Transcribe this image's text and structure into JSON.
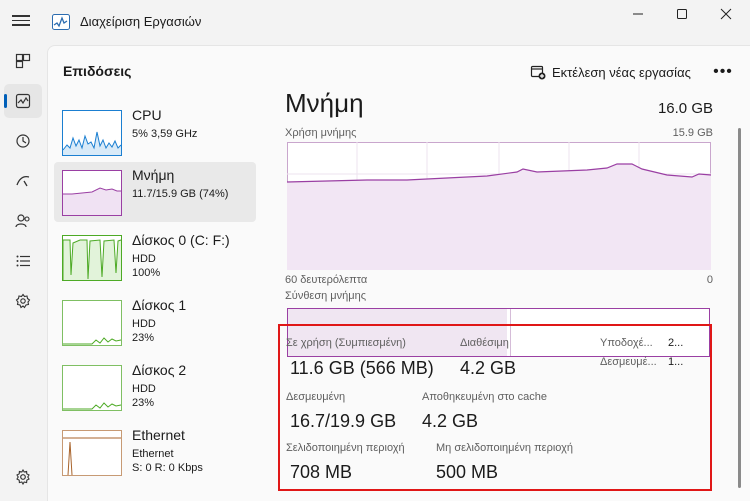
{
  "window": {
    "title": "Διαχείριση Εργασιών"
  },
  "header": {
    "title": "Επιδόσεις",
    "run_task_label": "Εκτέλεση νέας εργασίας",
    "more_label": "•••"
  },
  "rail": {
    "items": [
      {
        "icon": "processes-icon"
      },
      {
        "icon": "performance-icon",
        "active": true
      },
      {
        "icon": "app-history-icon"
      },
      {
        "icon": "startup-apps-icon"
      },
      {
        "icon": "users-icon"
      },
      {
        "icon": "details-icon"
      },
      {
        "icon": "services-icon"
      }
    ],
    "settings_icon": "gear-icon"
  },
  "devices": [
    {
      "name": "CPU",
      "line1": "5%  3,59 GHz",
      "line2": "",
      "color": "#1b7fd1"
    },
    {
      "name": "Μνήμη",
      "line1": "11.7/15.9 GB (74%)",
      "line2": "",
      "color": "#9a3fa3",
      "active": true
    },
    {
      "name": "Δίσκος 0 (C: F:)",
      "line1": "HDD",
      "line2": "100%",
      "color": "#4daa25"
    },
    {
      "name": "Δίσκος 1",
      "line1": "HDD",
      "line2": "23%",
      "color": "#4daa25"
    },
    {
      "name": "Δίσκος 2",
      "line1": "HDD",
      "line2": "23%",
      "color": "#4daa25"
    },
    {
      "name": "Ethernet",
      "line1": "Ethernet",
      "line2": "S: 0 R: 0 Kbps",
      "color": "#a8632b"
    }
  ],
  "memory": {
    "heading": "Μνήμη",
    "total": "16.0 GB",
    "usage_label": "Χρήση μνήμης",
    "usage_max": "15.9 GB",
    "time_start": "60 δευτερόλεπτα",
    "time_end": "0",
    "composition_label": "Σύνθεση μνήμης",
    "composition_in_use_fraction": 0.52,
    "stats": {
      "in_use_label": "Σε χρήση (Συμπιεσμένη)",
      "in_use_value": "11.6 GB (566 MB)",
      "available_label": "Διαθέσιμη",
      "available_value": "4.2 GB",
      "slots_label": "Υποδοχέ...",
      "slots_value": "2...",
      "reserved_label": "Δεσμευμέ...",
      "reserved_value": "1...",
      "committed_label": "Δεσμευμένη",
      "committed_value": "16.7/19.9 GB",
      "cached_label": "Αποθηκευμένη στο cache",
      "cached_value": "4.2 GB",
      "paged_label": "Σελιδοποιημένη περιοχή",
      "paged_value": "708 MB",
      "nonpaged_label": "Μη σελιδοποιημένη περιοχή",
      "nonpaged_value": "500 MB"
    }
  },
  "colors": {
    "memory": "#9a3fa3",
    "highlight": "#e01717",
    "accent": "#005fb8"
  }
}
